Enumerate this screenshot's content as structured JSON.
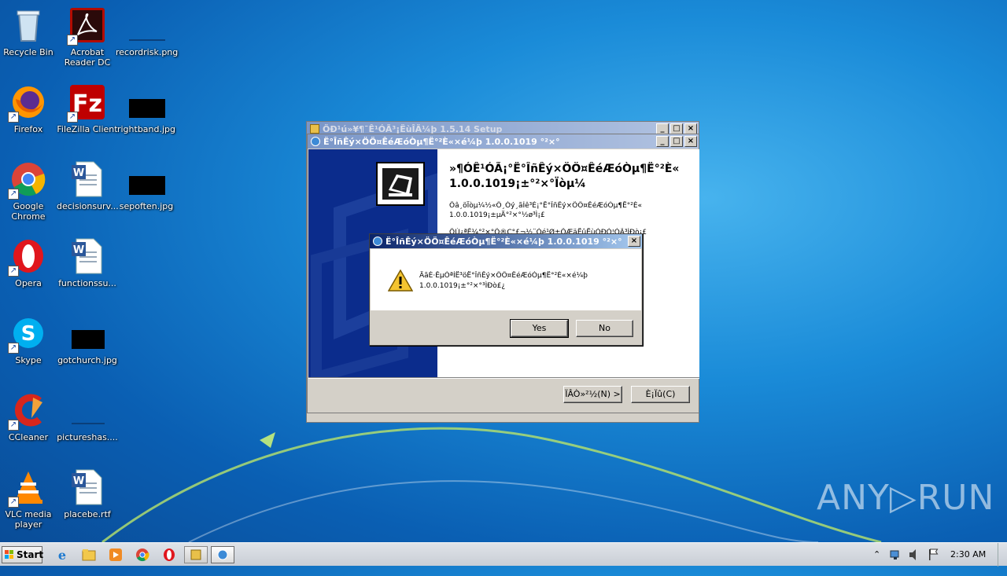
{
  "desktop": {
    "icons": [
      {
        "label": "Recycle Bin"
      },
      {
        "label": "Acrobat Reader DC"
      },
      {
        "label": "recordrisk.png"
      },
      {
        "label": "Firefox"
      },
      {
        "label": "FileZilla Client"
      },
      {
        "label": "rightband.jpg"
      },
      {
        "label": "Google Chrome"
      },
      {
        "label": "decisionsurv..."
      },
      {
        "label": "sepoften.jpg"
      },
      {
        "label": "Opera"
      },
      {
        "label": "functionssu..."
      },
      {
        "label": "Skype"
      },
      {
        "label": "gotchurch.jpg"
      },
      {
        "label": "CCleaner"
      },
      {
        "label": "pictureshas...."
      },
      {
        "label": "VLC media player"
      },
      {
        "label": "placebe.rtf"
      }
    ]
  },
  "back_window": {
    "title": "ÖÐ¹ú»¥¶¯Ê¹ÓÃ³¡ËùÎÄ¼þ 1.5.14 Setup"
  },
  "installer": {
    "title": "Ë°ÎñÊý×ÖÖ¤ÊéÆóÒµ¶Ë°²È«×é¼þ 1.0.0.1019 °²×°",
    "heading_line1": "»¶Ó­Ê¹ÓÃ¡°Ë°ÎñÊý×ÖÖ¤ÊéÆóÒµ¶Ë°²È«",
    "heading_line2": "1.0.0.1019¡±°²×°Ïòµ¼",
    "body_line1": "Õâ¸öÏòµ¼½«Ö¸Òý¸ãÍê³É¡°Ë°ÎñÊý×ÖÖ¤ÊéÆóÒµ¶Ë°²È«",
    "body_line2": "1.0.0.1019¡±µÄ°²×°½ø³Ì¡£",
    "body_line3": "ÔÚ¿ªÊ¼°²×°Ö®Ç°£¬½¨Òé¹Ø±ÕÆäËûËùÓÐÓ¦ÓÃ³ÌÐò¡£",
    "next_button": "ÏÂÒ»²½(N) >",
    "cancel_button": "È¡Ïû(C)"
  },
  "dialog": {
    "title": "Ë°ÎñÊý×ÖÖ¤ÊéÆóÒµ¶Ë°²È«×é¼þ 1.0.0.1019 °²×°",
    "message_line1": "ÄãÈ·ÊµÒªÍË³öË°ÎñÊý×ÖÖ¤ÊéÆóÒµ¶Ë°²È«×é¼þ",
    "message_line2": "1.0.0.1019¡±°²×°³ÌÐò£¿",
    "yes_button": "Yes",
    "no_button": "No",
    "close_glyph": "×"
  },
  "taskbar": {
    "start_label": "Start",
    "clock": "2:30 AM"
  },
  "watermark": "ANY▷RUN",
  "colors": {
    "installer_sidebar": "#0b2c8c",
    "dialog_title_active": "#0a246a",
    "titlebar_inactive": "#7a96c8"
  }
}
